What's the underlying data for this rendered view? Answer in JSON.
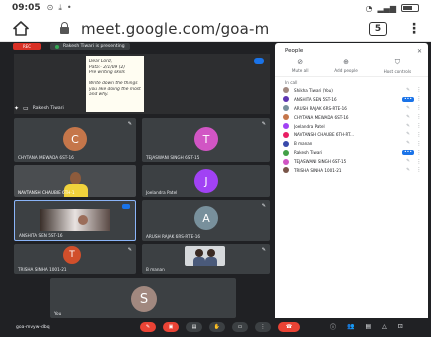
{
  "statusbar": {
    "time": "09:05"
  },
  "browser": {
    "url": "meet.google.com/goa-m",
    "tab_count": "5"
  },
  "meeting": {
    "rec_label": "REC",
    "presenting_text": "Rakesh Tiwari is presenting",
    "presenter_name": "Rakesh Tiwari",
    "meeting_code": "goa-mvyw-dbq"
  },
  "slide": {
    "lines": [
      "Dear Lord,",
      "Pata:- 2/1/09 (2)",
      "Pre writing skills",
      "",
      "Write down the things",
      "you like doing the most",
      "and why."
    ]
  },
  "tiles": [
    {
      "name": "CHYTANA MEWADA 6ST-16",
      "initial": "C",
      "color": "#c5764a"
    },
    {
      "name": "TEJASWANI SINGH 6ST-15",
      "initial": "T",
      "color": "#d155c4"
    },
    {
      "name": "NAVTANSH CHAUBIE 6TH-1",
      "initial": ""
    },
    {
      "name": "Joelandra Patel",
      "initial": "J",
      "color": "#a142f4"
    },
    {
      "name": "ANSHITA SEN 5ST-16",
      "initial": ""
    },
    {
      "name": "ARUSH RAJAK 6RS-RTE-16",
      "initial": "A",
      "color": "#78909c"
    },
    {
      "name": "TRISHA SINHA 1001-21",
      "initial": "T",
      "color": "#d14f2b"
    },
    {
      "name": "B manan",
      "initial": ""
    },
    {
      "name": "You",
      "initial": "S",
      "color": "#a1887f"
    }
  ],
  "panel": {
    "title": "People",
    "close": "✕",
    "actions": [
      {
        "label": "Mute all",
        "icon": "mic-off-icon"
      },
      {
        "label": "Add people",
        "icon": "person-add-icon"
      },
      {
        "label": "Host controls",
        "icon": "shield-icon"
      }
    ],
    "in_call_label": "In call",
    "people": [
      {
        "name": "Shikha Tiwari (You)",
        "color": "#a1887f",
        "active": false
      },
      {
        "name": "ANSHITA SEN 5ST-16",
        "color": "#5e35b1",
        "active": true
      },
      {
        "name": "ARUSH RAJAK 6RS-RTE-16",
        "color": "#78909c",
        "active": false
      },
      {
        "name": "CHYTANA MEWADA 6ST-16",
        "color": "#c5764a",
        "active": false
      },
      {
        "name": "Joelandra Patel",
        "color": "#a142f4",
        "active": false
      },
      {
        "name": "NAVTANSH CHAUBE 6TH-RT...",
        "color": "#e91e63",
        "active": false
      },
      {
        "name": "B manan",
        "color": "#3949ab",
        "active": false
      },
      {
        "name": "Rakesh Tiwari",
        "color": "#43a047",
        "active": true
      },
      {
        "name": "TEJASWANI SINGH 6ST-15",
        "color": "#d155c4",
        "active": false
      },
      {
        "name": "TRISHA SINHA 1001-21",
        "color": "#795548",
        "active": false
      }
    ]
  }
}
